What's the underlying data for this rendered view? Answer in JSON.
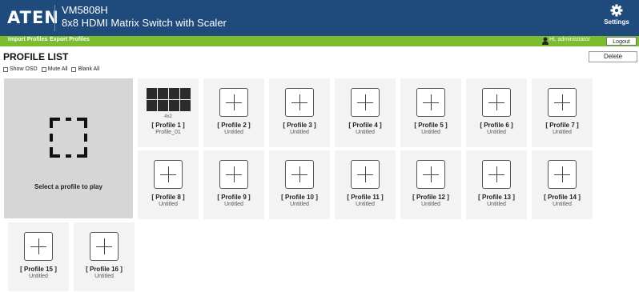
{
  "header": {
    "logo": "ATEN",
    "model": "VM5808H",
    "description": "8x8 HDMI Matrix Switch with Scaler",
    "settings_label": "Settings",
    "settings_icon": "gear-icon"
  },
  "menubar": {
    "import_label": "Import Profiles",
    "export_label": "Export Profiles",
    "user_greeting": "Hi, administrator",
    "logout_label": "Logout"
  },
  "page": {
    "title": "PROFILE LIST",
    "delete_label": "Delete",
    "options": [
      "Show OSD",
      "Mute All",
      "Blank All"
    ]
  },
  "preview": {
    "text": "Select a profile to play"
  },
  "profiles": [
    {
      "name": "[ Profile 1 ]",
      "desc": "Profile_01",
      "layout": "4x2"
    },
    {
      "name": "[ Profile 2 ]",
      "desc": "Untitled"
    },
    {
      "name": "[ Profile 3 ]",
      "desc": "Untitled"
    },
    {
      "name": "[ Profile 4 ]",
      "desc": "Untitled"
    },
    {
      "name": "[ Profile 5 ]",
      "desc": "Untitled"
    },
    {
      "name": "[ Profile 6 ]",
      "desc": "Untitled"
    },
    {
      "name": "[ Profile 7 ]",
      "desc": "Untitled"
    },
    {
      "name": "[ Profile 8 ]",
      "desc": "Untitled"
    },
    {
      "name": "[ Profile 9 ]",
      "desc": "Untitled"
    },
    {
      "name": "[ Profile 10 ]",
      "desc": "Untitled"
    },
    {
      "name": "[ Profile 11 ]",
      "desc": "Untitled"
    },
    {
      "name": "[ Profile 12 ]",
      "desc": "Untitled"
    },
    {
      "name": "[ Profile 13 ]",
      "desc": "Untitled"
    },
    {
      "name": "[ Profile 14 ]",
      "desc": "Untitled"
    },
    {
      "name": "[ Profile 15 ]",
      "desc": "Untitled"
    },
    {
      "name": "[ Profile 16 ]",
      "desc": "Untitled"
    }
  ],
  "colors": {
    "header_bg": "#1f4a7c",
    "menubar_bg": "#7cbd2f",
    "card_bg": "#f3f3f3",
    "preview_bg": "#d6d6d6"
  }
}
